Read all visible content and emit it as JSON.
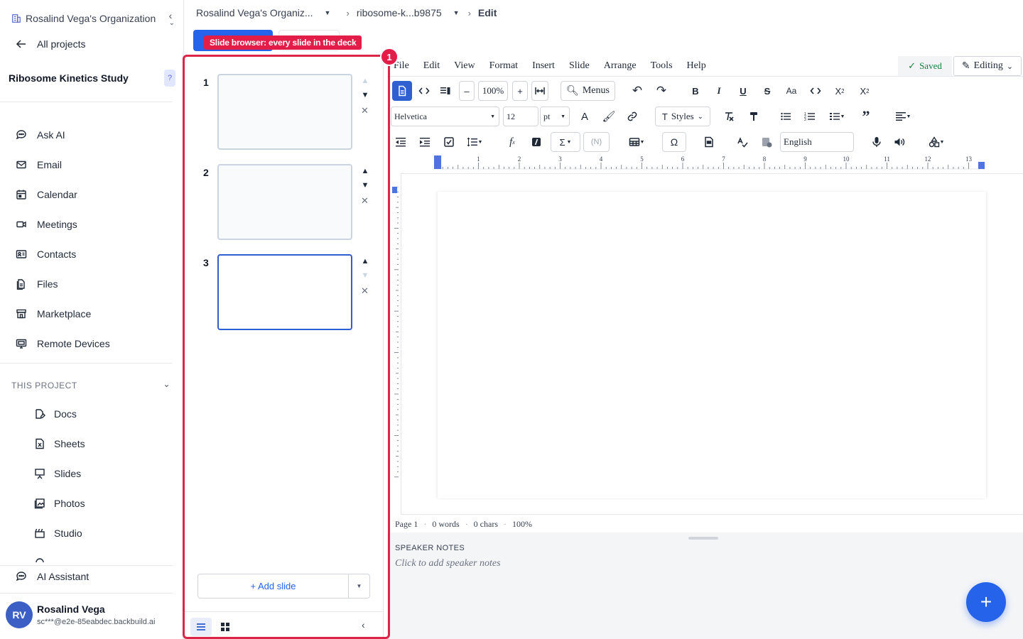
{
  "sidebar": {
    "org_name": "Rosalind Vega's Organization",
    "all_projects": "All projects",
    "project_title": "Ribosome Kinetics Study",
    "help_badge": "?",
    "nav": [
      "Ask AI",
      "Email",
      "Calendar",
      "Meetings",
      "Contacts",
      "Files",
      "Marketplace",
      "Remote Devices"
    ],
    "section_label": "THIS PROJECT",
    "project_items": [
      "Docs",
      "Sheets",
      "Slides",
      "Photos",
      "Studio"
    ],
    "ai_assistant": "AI Assistant",
    "user": {
      "initials": "RV",
      "name": "Rosalind Vega",
      "email": "sc***@e2e-85eabdec.backbuild.ai"
    }
  },
  "breadcrumb": {
    "org": "Rosalind Vega's Organiz...",
    "doc": "ribosome-k...b9875",
    "current": "Edit"
  },
  "callout": {
    "label": "Slide browser: every slide in the deck",
    "number": "1",
    "color": "#e11d48"
  },
  "slides": {
    "items": [
      {
        "number": "1",
        "selected": false
      },
      {
        "number": "2",
        "selected": false
      },
      {
        "number": "3",
        "selected": true
      }
    ],
    "add_label": "+ Add slide"
  },
  "editor": {
    "menus": [
      "File",
      "Edit",
      "View",
      "Format",
      "Insert",
      "Slide",
      "Arrange",
      "Tools",
      "Help"
    ],
    "saved": "Saved",
    "mode": "Editing",
    "zoom": "100%",
    "menus_button": "Menus",
    "font": "Helvetica",
    "font_size": "12",
    "unit": "pt",
    "styles": "Styles",
    "language": "English",
    "ruler_numbers": [
      "1",
      "2",
      "3",
      "4",
      "5",
      "6",
      "7",
      "8",
      "9",
      "10",
      "11",
      "12",
      "13"
    ],
    "status": {
      "page": "Page 1",
      "words": "0 words",
      "chars": "0 chars",
      "zoom": "100%"
    },
    "notes_title": "SPEAKER NOTES",
    "notes_placeholder": "Click to add speaker notes"
  },
  "colors": {
    "accent": "#2563eb",
    "callout": "#e11d48",
    "saved": "#15803d"
  }
}
